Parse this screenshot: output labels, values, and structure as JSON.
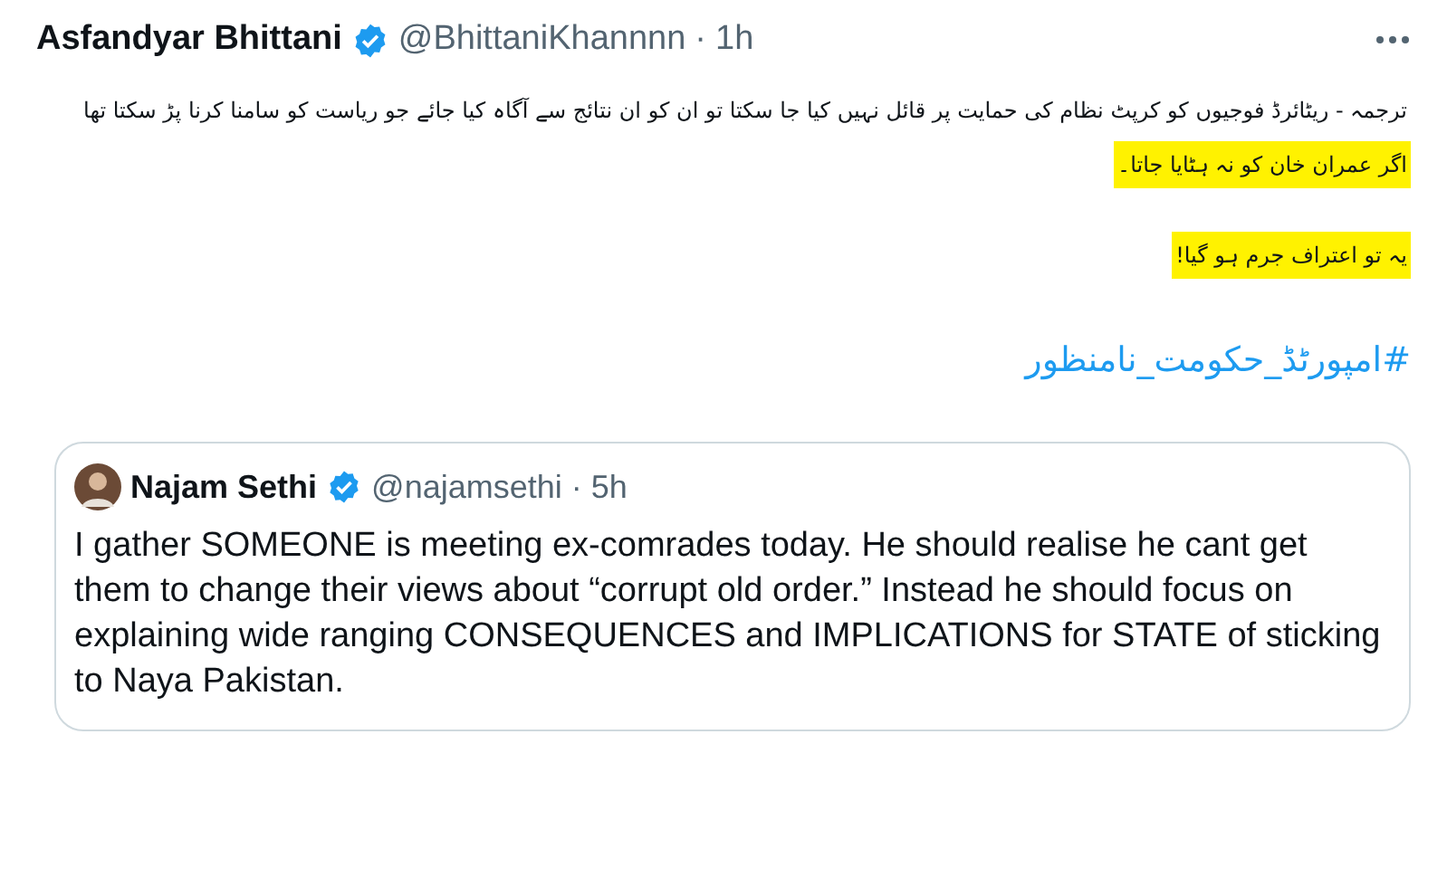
{
  "tweet": {
    "author": "Asfandyar Bhittani",
    "verified": true,
    "handle": "@BhittaniKhannnn",
    "separator": "·",
    "time": "1h",
    "paragraphs": [
      {
        "lines": [
          {
            "text": "ترجمہ - ریٹائرڈ فوجیوں کو کرپٹ نظام کی حمایت پر قائل نہیں کیا جا سکتا تو ان کو ان نتائج سے آگاہ کیا جائے جو ریاست کو سامنا کرنا پڑ سکتا تھا",
            "highlighted": false
          },
          {
            "text": "اگر عمران خان کو نہ ہٹایا جاتا۔",
            "highlighted": true
          }
        ]
      },
      {
        "lines": [
          {
            "text": "یہ تو اعتراف جرم ہو گیا!",
            "highlighted": true
          }
        ]
      }
    ],
    "hashtag": "#امپورٹڈ_حکومت_نامنظور",
    "quote": {
      "author": "Najam Sethi",
      "verified": true,
      "handle": "@najamsethi",
      "separator": "·",
      "time": "5h",
      "text": "I gather SOMEONE is meeting ex-comrades today. He should realise he cant get them to change their views about “corrupt old order.” Instead he should focus on explaining wide ranging CONSEQUENCES and IMPLICATIONS for STATE of sticking to Naya Pakistan."
    }
  }
}
